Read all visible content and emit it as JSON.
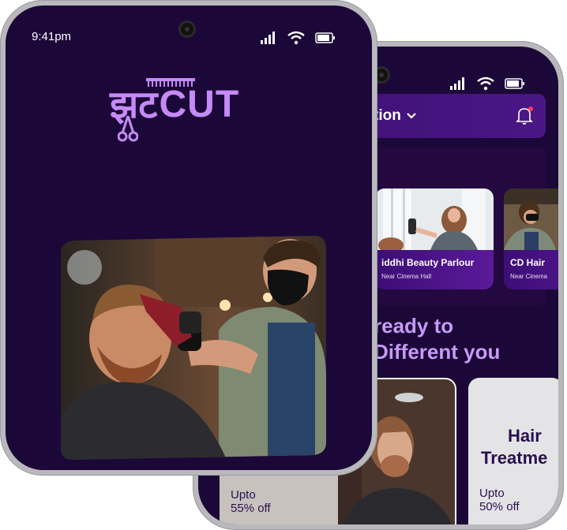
{
  "status": {
    "time": "9:41pm"
  },
  "back": {
    "header": {
      "location_partial": "tion"
    },
    "salons": [
      {
        "name": "iddhi Beauty Parlour",
        "address": "Near Cinema Hall"
      },
      {
        "name": "CD Hair",
        "address": "Near Cinema"
      }
    ],
    "tagline": {
      "line1": "ready to",
      "line2": "Different you"
    },
    "offers": [
      {
        "label": "Upto",
        "discount": "55% off"
      },
      {
        "title1": "Hair",
        "title2": "Treatme",
        "label": "Upto",
        "discount": "50% off"
      }
    ]
  },
  "front": {
    "logo": {
      "devanagari": "झट",
      "latin": "CUT"
    }
  },
  "colors": {
    "background": "#1c0838",
    "accent": "#c58af7",
    "card": "#4a1685"
  }
}
